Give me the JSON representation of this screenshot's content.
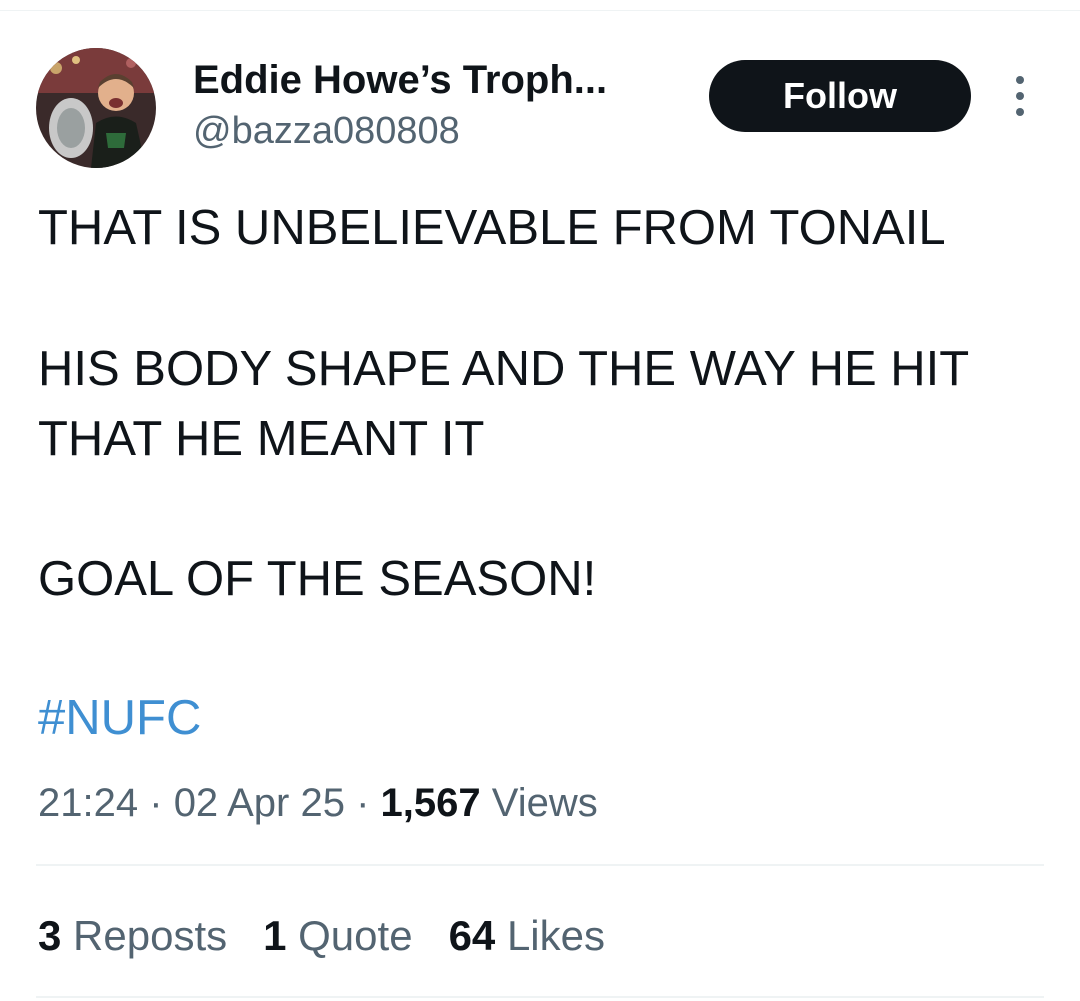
{
  "author": {
    "display_name": "Eddie Howe’s Troph...",
    "handle": "@bazza080808",
    "avatar_icon": "avatar-photo"
  },
  "actions": {
    "follow_label": "Follow",
    "more_icon": "more-vertical-icon"
  },
  "tweet": {
    "lines": [
      "THAT IS UNBELIEVABLE FROM TONAIL",
      "HIS BODY SHAPE AND THE WAY HE HIT",
      "THAT HE MEANT IT",
      "GOAL OF THE SEASON!"
    ],
    "hashtag": "#NUFC"
  },
  "meta": {
    "time": "21:24",
    "separator": "·",
    "date": "02 Apr 25",
    "views_count": "1,567",
    "views_label": "Views"
  },
  "stats": {
    "reposts_count": "3",
    "reposts_label": "Reposts",
    "quotes_count": "1",
    "quotes_label": "Quote",
    "likes_count": "64",
    "likes_label": "Likes"
  },
  "colors": {
    "text": "#0f1419",
    "secondary": "#536471",
    "hashtag": "#3f8fd2",
    "follow_bg": "#0f1419",
    "divider": "#eff3f4"
  }
}
